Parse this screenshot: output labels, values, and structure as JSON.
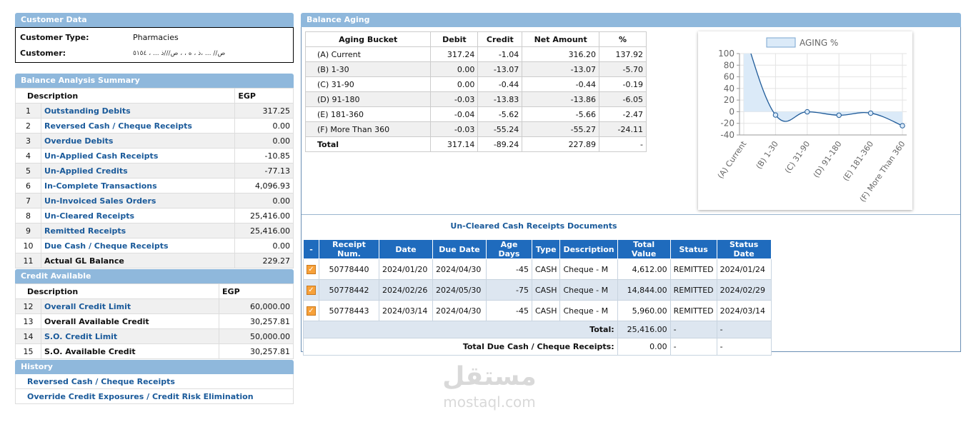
{
  "customer_data": {
    "title": "Customer Data",
    "type_label": "Customer Type:",
    "type_value": "Pharmacies",
    "customer_label": "Customer:",
    "customer_value": "ص// ... ،ذ  ، ه ، ، ص///ذ ... ، ٥١٥٤"
  },
  "balance_summary": {
    "title": "Balance Analysis Summary",
    "col_description": "Description",
    "col_currency": "EGP",
    "rows": [
      {
        "no": "1",
        "label": "Outstanding Debits",
        "value": "317.25"
      },
      {
        "no": "2",
        "label": "Reversed Cash / Cheque Receipts",
        "value": "0.00"
      },
      {
        "no": "3",
        "label": "Overdue Debits",
        "value": "0.00"
      },
      {
        "no": "4",
        "label": "Un-Applied Cash Receipts",
        "value": "-10.85"
      },
      {
        "no": "5",
        "label": "Un-Applied Credits",
        "value": "-77.13"
      },
      {
        "no": "6",
        "label": "In-Complete Transactions",
        "value": "4,096.93"
      },
      {
        "no": "7",
        "label": "Un-Invoiced Sales Orders",
        "value": "0.00"
      },
      {
        "no": "8",
        "label": "Un-Cleared Receipts",
        "value": "25,416.00"
      },
      {
        "no": "9",
        "label": "Remitted Receipts",
        "value": "25,416.00"
      },
      {
        "no": "10",
        "label": "Due Cash / Cheque Receipts",
        "value": "0.00"
      },
      {
        "no": "11",
        "label": "Actual GL Balance",
        "value": "229.27"
      }
    ]
  },
  "credit_available": {
    "title": "Credit Available",
    "col_description": "Description",
    "col_currency": "EGP",
    "rows": [
      {
        "no": "12",
        "label": "Overall Credit Limit",
        "value": "60,000.00"
      },
      {
        "no": "13",
        "label": "Overall Available Credit",
        "value": "30,257.81"
      },
      {
        "no": "14",
        "label": "S.O. Credit Limit",
        "value": "50,000.00"
      },
      {
        "no": "15",
        "label": "S.O. Available Credit",
        "value": "30,257.81"
      }
    ]
  },
  "history": {
    "title": "History",
    "links": [
      "Reversed Cash / Cheque Receipts",
      "Override Credit Exposures / Credit Risk Elimination"
    ]
  },
  "balance_aging": {
    "title": "Balance Aging",
    "headers": [
      "Aging Bucket",
      "Debit",
      "Credit",
      "Net Amount",
      "%"
    ],
    "rows": [
      [
        "(A) Current",
        "317.24",
        "-1.04",
        "316.20",
        "137.92"
      ],
      [
        "(B) 1-30",
        "0.00",
        "-13.07",
        "-13.07",
        "-5.70"
      ],
      [
        "(C) 31-90",
        "0.00",
        "-0.44",
        "-0.44",
        "-0.19"
      ],
      [
        "(D) 91-180",
        "-0.03",
        "-13.83",
        "-13.86",
        "-6.05"
      ],
      [
        "(E) 181-360",
        "-0.04",
        "-5.62",
        "-5.66",
        "-2.47"
      ],
      [
        "(F) More Than 360",
        "-0.03",
        "-55.24",
        "-55.27",
        "-24.11"
      ],
      [
        "Total",
        "317.14",
        "-89.24",
        "227.89",
        "-"
      ]
    ]
  },
  "chart_data": {
    "type": "line",
    "title": "",
    "categories": [
      "(A) Current",
      "(B) 1-30",
      "(C) 31-90",
      "(D) 91-180",
      "(E) 181-360",
      "(F) More Than 360"
    ],
    "series": [
      {
        "name": "AGING %",
        "values": [
          137.92,
          -5.7,
          -0.19,
          -6.05,
          -2.47,
          -24.11
        ]
      }
    ],
    "ylim": [
      -40,
      100
    ],
    "yticks": [
      -40,
      -20,
      0,
      20,
      40,
      60,
      80,
      100
    ],
    "grid": true,
    "legend": "top-center",
    "line_color": "#1f5b99",
    "fill_color": "#dbeaf8",
    "xlabel": "",
    "ylabel": ""
  },
  "uncleared": {
    "title": "Un-Cleared Cash Receipts Documents",
    "headers": [
      "-",
      "Receipt Num.",
      "Date",
      "Due Date",
      "Age Days",
      "Type",
      "Description",
      "Total Value",
      "Status",
      "Status Date"
    ],
    "rows": [
      [
        "50778440",
        "2024/01/20",
        "2024/04/30",
        "-45",
        "CASH",
        "Cheque - M",
        "4,612.00",
        "REMITTED",
        "2024/01/24"
      ],
      [
        "50778442",
        "2024/02/26",
        "2024/05/30",
        "-75",
        "CASH",
        "Cheque - M",
        "14,844.00",
        "REMITTED",
        "2024/02/29"
      ],
      [
        "50778443",
        "2024/03/14",
        "2024/04/30",
        "-45",
        "CASH",
        "Cheque - M",
        "5,960.00",
        "REMITTED",
        "2024/03/14"
      ]
    ],
    "total_label": "Total:",
    "total_value": "25,416.00",
    "total_due_label": "Total Due Cash / Cheque Receipts:",
    "total_due_value": "0.00",
    "dash": "-"
  },
  "watermark": {
    "arabic": "مستقل",
    "latin": "mostaql.com"
  }
}
